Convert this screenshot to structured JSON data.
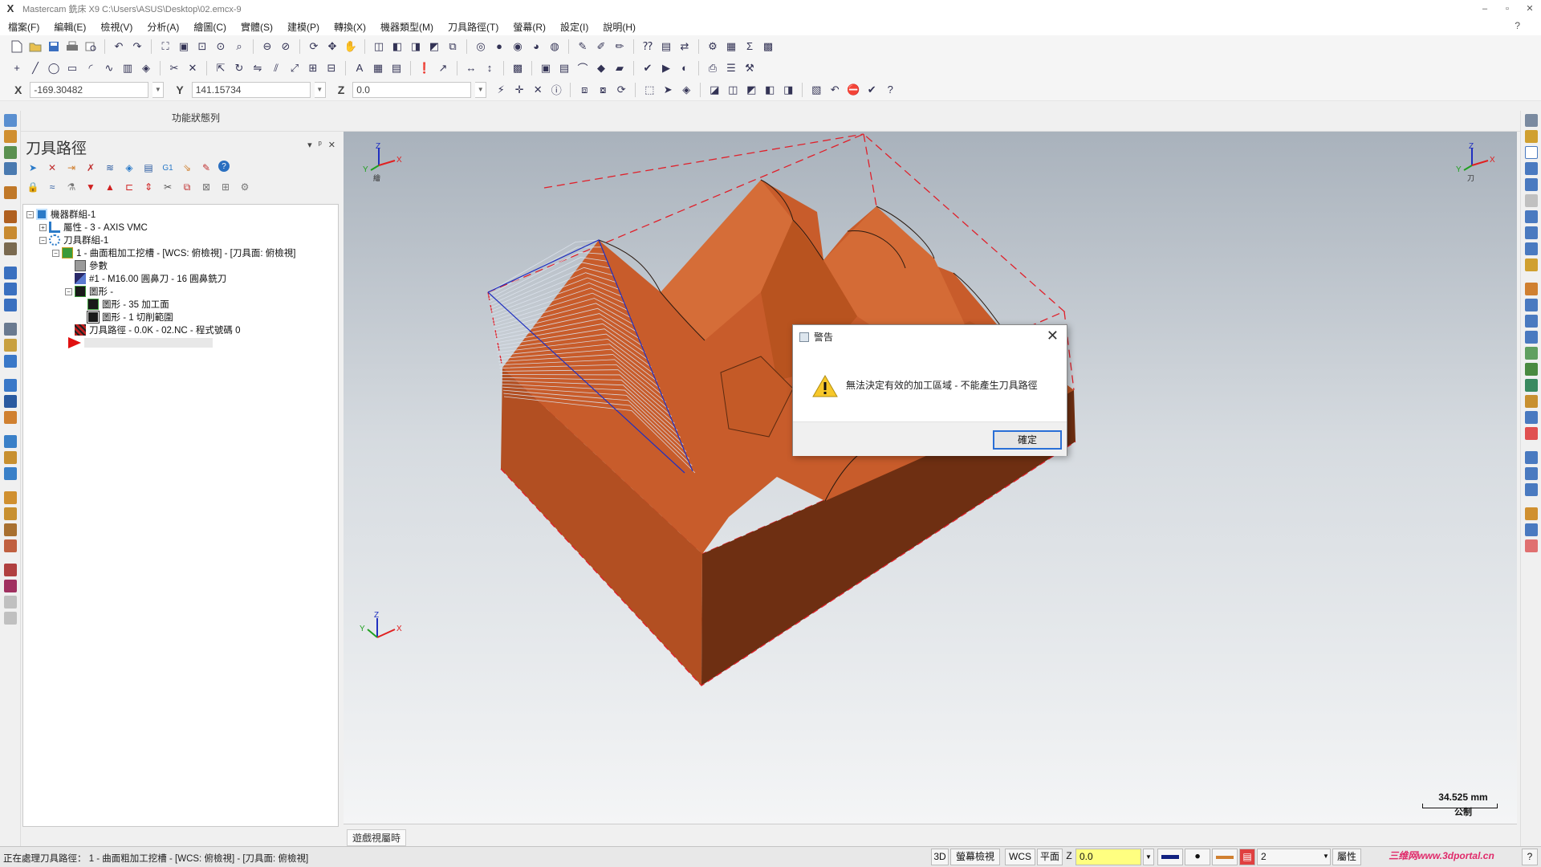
{
  "window": {
    "title": "Mastercam 銑床 X9  C:\\Users\\ASUS\\Desktop\\02.emcx-9",
    "logo_glyph": "X",
    "minimize": "–",
    "restore": "▫",
    "close": "✕"
  },
  "menu": [
    "檔案(F)",
    "編輯(E)",
    "檢視(V)",
    "分析(A)",
    "繪圖(C)",
    "實體(S)",
    "建模(P)",
    "轉換(X)",
    "機器類型(M)",
    "刀具路徑(T)",
    "螢幕(R)",
    "設定(I)",
    "說明(H)"
  ],
  "menu_help_icon": "?",
  "coords": {
    "x_label": "X",
    "x_value": "-169.30482",
    "y_label": "Y",
    "y_value": "141.15734",
    "z_label": "Z",
    "z_value": "0.0"
  },
  "status_row_label": "功能狀態列",
  "panel": {
    "title": "刀具路徑",
    "pin": "ᵖ",
    "close": "✕",
    "dropdown": "▾",
    "g1_label": "G1",
    "help": "?"
  },
  "tree": {
    "machine_group": "機器群組-1",
    "properties": "屬性 - 3 - AXIS VMC",
    "toolpath_group": "刀具群組-1",
    "operation": "1 - 曲面粗加工挖槽 - [WCS: 俯檢視] - [刀具面: 俯檢視]",
    "parameters": "參數",
    "tool": "#1 - M16.00 圓鼻刀 - 16 圓鼻銑刀",
    "geometry": "圖形 -",
    "geo_drive": "圖形 - 35 加工面",
    "geo_boundary": "圖形 - 1 切削範圍",
    "toolpath": "刀具路徑 - 0.0K - 02.NC - 程式號碼 0"
  },
  "viewport": {
    "gnomon_z": "Z",
    "gnomon_x": "X",
    "gnomon_y": "Y",
    "gnomon_top_left_label": "繪",
    "gnomon_top_right_label": "刀",
    "scale_value": "34.525 mm",
    "scale_unit": "公制",
    "view_tab": "遊戲視屬時"
  },
  "dialog": {
    "title": "警告",
    "message": "無法決定有效的加工區域 - 不能產生刀具路徑",
    "ok_button": "確定",
    "close": "✕"
  },
  "statusbar": {
    "message": "正在處理刀具路徑：  1 - 曲面粗加工挖槽 - [WCS: 俯檢視] - [刀具面: 俯檢視]",
    "view_3d": "3D",
    "screen_view": "螢幕檢視",
    "wcs": "WCS",
    "plane": "平面",
    "z_label": "Z",
    "z_value": "0.0",
    "level": "2",
    "properties": "屬性",
    "watermark": "三维网www.3dportal.cn",
    "help": "?"
  },
  "colors": {
    "part_orange": "#c75a2a",
    "part_dark": "#7a3616",
    "toolpath_lines": "#cfd8e6",
    "boundary_red": "#e0202a",
    "ok_border": "#2a6fd6"
  }
}
